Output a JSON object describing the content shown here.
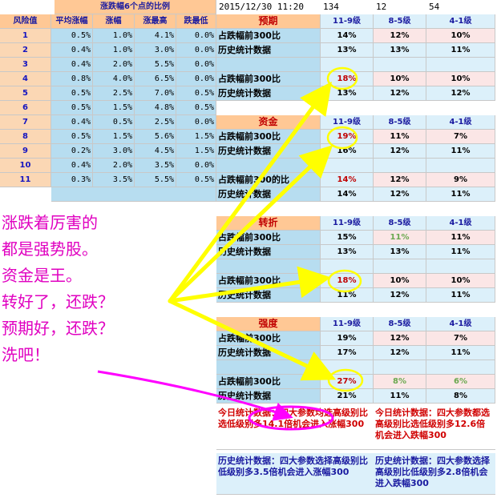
{
  "top_info": {
    "datetime": "2015/12/30 11:20",
    "v1": "134",
    "v2": "12",
    "v3": "54"
  },
  "left_table": {
    "title": "涨跌幅6个点的比例",
    "headers": [
      "风险值",
      "平均涨幅",
      "涨幅",
      "涨最高",
      "跌最低"
    ],
    "rows": [
      [
        "1",
        "0.5%",
        "1.0%",
        "4.1%",
        "0.0%"
      ],
      [
        "2",
        "0.4%",
        "1.0%",
        "3.0%",
        "0.0%"
      ],
      [
        "3",
        "0.4%",
        "2.0%",
        "5.5%",
        "0.0%"
      ],
      [
        "4",
        "0.8%",
        "4.0%",
        "6.5%",
        "0.0%"
      ],
      [
        "5",
        "0.5%",
        "2.5%",
        "7.0%",
        "0.5%"
      ],
      [
        "6",
        "0.5%",
        "1.5%",
        "4.8%",
        "0.5%"
      ],
      [
        "7",
        "0.4%",
        "0.5%",
        "2.5%",
        "0.0%"
      ],
      [
        "8",
        "0.5%",
        "1.5%",
        "5.6%",
        "1.5%"
      ],
      [
        "9",
        "0.2%",
        "3.0%",
        "4.5%",
        "1.5%"
      ],
      [
        "10",
        "0.4%",
        "2.0%",
        "3.5%",
        "0.0%"
      ],
      [
        "11",
        "0.3%",
        "3.5%",
        "5.5%",
        "0.5%"
      ]
    ]
  },
  "levels": [
    "11-9级",
    "8-5级",
    "4-1级"
  ],
  "blocks": [
    {
      "title": "预期",
      "rows": [
        {
          "label": "占跌幅前300比",
          "vals": [
            "14%",
            "12%",
            "10%"
          ]
        },
        {
          "label": "历史统计数据",
          "vals": [
            "13%",
            "13%",
            "11%"
          ]
        },
        {
          "label": "",
          "vals": [
            "",
            "",
            ""
          ]
        },
        {
          "label": "占跌幅前300比",
          "vals": [
            "18%",
            "10%",
            "10%"
          ]
        },
        {
          "label": "历史统计数据",
          "vals": [
            "13%",
            "12%",
            "12%"
          ]
        }
      ]
    },
    {
      "title": "资金",
      "rows": [
        {
          "label": "占跌幅前300比",
          "vals": [
            "19%",
            "11%",
            "7%"
          ]
        },
        {
          "label": "历史统计数据",
          "vals": [
            "16%",
            "12%",
            "11%"
          ]
        },
        {
          "label": "",
          "vals": [
            "",
            "",
            ""
          ]
        },
        {
          "label": "占跌幅前300的比",
          "vals": [
            "14%",
            "12%",
            "9%"
          ]
        },
        {
          "label": "历史统计数据",
          "vals": [
            "14%",
            "12%",
            "11%"
          ]
        }
      ]
    },
    {
      "title": "转折",
      "rows": [
        {
          "label": "占跌幅前300比",
          "vals": [
            "15%",
            "11%",
            "11%"
          ]
        },
        {
          "label": "历史统计数据",
          "vals": [
            "13%",
            "13%",
            "11%"
          ]
        },
        {
          "label": "",
          "vals": [
            "",
            "",
            ""
          ]
        },
        {
          "label": "占跌幅前300比",
          "vals": [
            "18%",
            "10%",
            "10%"
          ]
        },
        {
          "label": "历史统计数据",
          "vals": [
            "11%",
            "12%",
            "11%"
          ]
        }
      ]
    },
    {
      "title": "强度",
      "rows": [
        {
          "label": "占跌幅前300比",
          "vals": [
            "19%",
            "12%",
            "7%"
          ]
        },
        {
          "label": "历史统计数据",
          "vals": [
            "17%",
            "12%",
            "11%"
          ]
        },
        {
          "label": "",
          "vals": [
            "",
            "",
            ""
          ]
        },
        {
          "label": "占跌幅前300比",
          "vals": [
            "27%",
            "8%",
            "6%"
          ]
        },
        {
          "label": "历史统计数据",
          "vals": [
            "21%",
            "11%",
            "8%"
          ]
        }
      ]
    }
  ],
  "notes": {
    "today_left": "今日统计数据：四大参数均选高级别比选低级别多14.1倍机会进入涨幅300",
    "today_right": "今日统计数据：四大参数都选高级别比选低级别多12.6倍机会进入跌幅300",
    "hist_left": "历史统计数据：四大参数选择高级别比低级别多3.5倍机会进入涨幅300",
    "hist_right": "历史统计数据：四大参数选择高级别比低级别多2.8倍机会进入跌幅300"
  },
  "annotation": {
    "lines": [
      "涨跌着厉害的",
      "都是强势股。",
      "资金是王。",
      "转好了，还跌？",
      "预期好，还跌？",
      "洗吧！"
    ],
    "color": "#e000c0",
    "arrow_yellow": "#ffff00",
    "arrow_magenta": "#ff00ff"
  }
}
